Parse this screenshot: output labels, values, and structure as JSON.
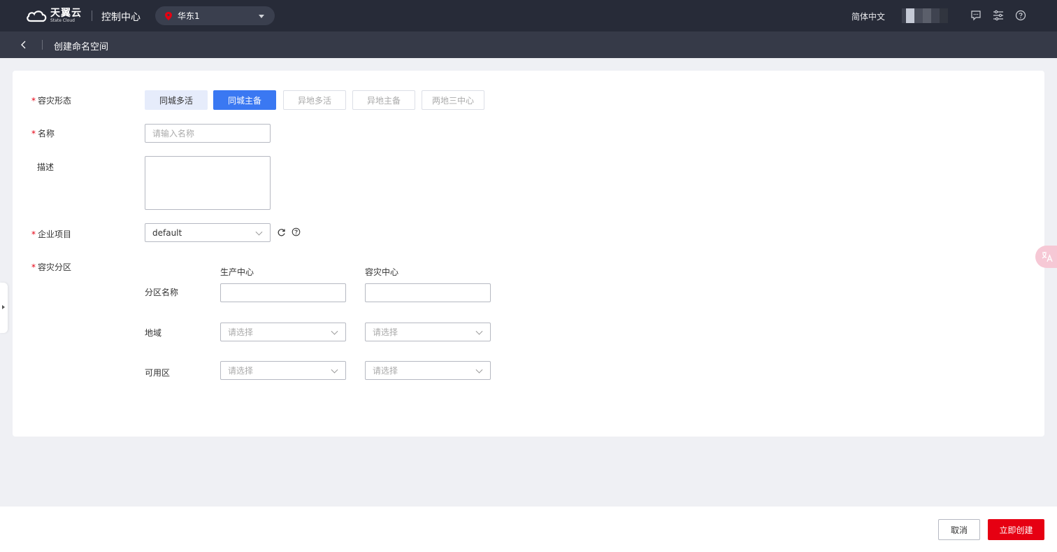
{
  "header": {
    "brand_cn": "天翼云",
    "brand_en": "State Cloud",
    "console_title": "控制中心",
    "region": "华东1",
    "language": "简体中文"
  },
  "subheader": {
    "title": "创建命名空间"
  },
  "form": {
    "dr_mode": {
      "label": "容灾形态",
      "options": [
        "同城多活",
        "同城主备",
        "异地多活",
        "异地主备",
        "两地三中心"
      ],
      "selected": "同城主备"
    },
    "name": {
      "label": "名称",
      "placeholder": "请输入名称"
    },
    "description": {
      "label": "描述",
      "value": ""
    },
    "project": {
      "label": "企业项目",
      "value": "default"
    },
    "partition": {
      "label": "容灾分区",
      "columns": [
        "生产中心",
        "容灾中心"
      ],
      "rows": {
        "name_label": "分区名称",
        "region_label": "地域",
        "zone_label": "可用区"
      },
      "select_placeholder": "请选择"
    }
  },
  "footer": {
    "cancel_label": "取消",
    "create_label": "立即创建"
  },
  "colors": {
    "topbar_bg": "#272b38",
    "subheader_bg": "#363a48",
    "active_segment": "#3a78f2",
    "primary_button": "#e60012",
    "required_mark": "#e60012"
  }
}
